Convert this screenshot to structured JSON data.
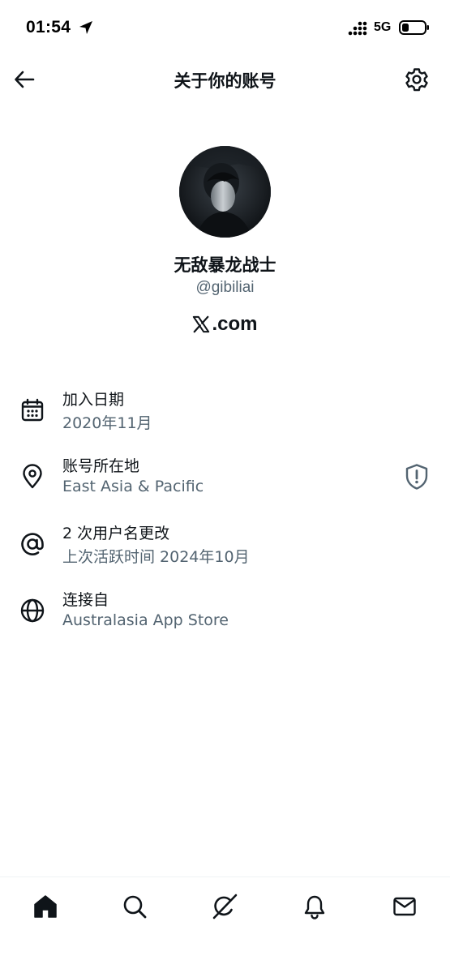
{
  "status_bar": {
    "time": "01:54",
    "network": "5G"
  },
  "header": {
    "title": "关于你的账号"
  },
  "profile": {
    "display_name": "无敌暴龙战士",
    "handle": "@gibiliai",
    "site_suffix": ".com"
  },
  "info_items": [
    {
      "icon": "calendar-icon",
      "label": "加入日期",
      "value": "2020年11月"
    },
    {
      "icon": "location-pin-icon",
      "label": "账号所在地",
      "value": "East Asia & Pacific"
    },
    {
      "icon": "at-sign-icon",
      "label": "2 次用户名更改",
      "value": "上次活跃时间 2024年10月"
    },
    {
      "icon": "globe-icon",
      "label": "连接自",
      "value": "Australasia App Store"
    }
  ],
  "tabs": [
    {
      "icon": "home-icon",
      "active": true
    },
    {
      "icon": "search-icon",
      "active": false
    },
    {
      "icon": "grok-icon",
      "active": false
    },
    {
      "icon": "bell-icon",
      "active": false
    },
    {
      "icon": "mail-icon",
      "active": false
    }
  ],
  "colors": {
    "primary_text": "#0f1419",
    "secondary_text": "#536471",
    "divider": "#eff3f4"
  }
}
